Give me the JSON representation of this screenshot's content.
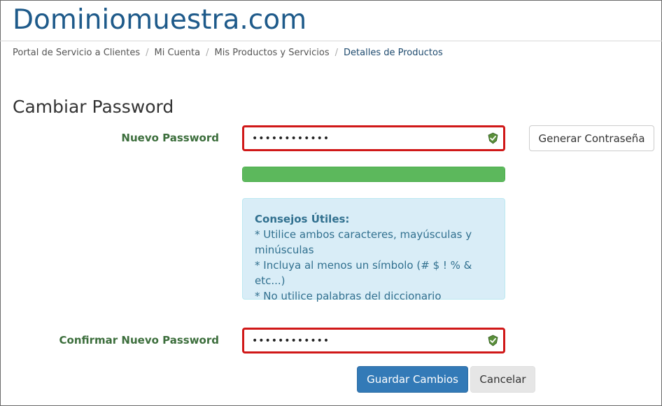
{
  "site": {
    "title": "Dominiomuestra.com"
  },
  "breadcrumb": {
    "items": [
      "Portal de Servicio a Clientes",
      "Mi Cuenta",
      "Mis Productos y Servicios"
    ],
    "active": "Detalles de Productos",
    "separator": "/"
  },
  "section": {
    "title": "Cambiar Password"
  },
  "form": {
    "new_password": {
      "label": "Nuevo Password",
      "value": "••••••••••••",
      "valid_icon": "check-shield-icon"
    },
    "confirm_password": {
      "label": "Confirmar Nuevo Password",
      "value": "••••••••••••",
      "valid_icon": "check-shield-icon"
    },
    "generate_button": "Generar Contraseña",
    "strength_level": 1.0
  },
  "tips": {
    "title": "Consejos Útiles:",
    "items": [
      "* Utilice ambos caracteres, mayúsculas y minúsculas",
      "* Incluya al menos un símbolo (# $ ! % & etc...)",
      "* No utilice palabras del diccionario"
    ]
  },
  "actions": {
    "save": "Guardar Cambios",
    "cancel": "Cancelar"
  },
  "colors": {
    "brand": "#1e5a8a",
    "error_border": "#d01818",
    "strength": "#5cb85c",
    "primary": "#337ab7",
    "label": "#3c6e3c"
  }
}
